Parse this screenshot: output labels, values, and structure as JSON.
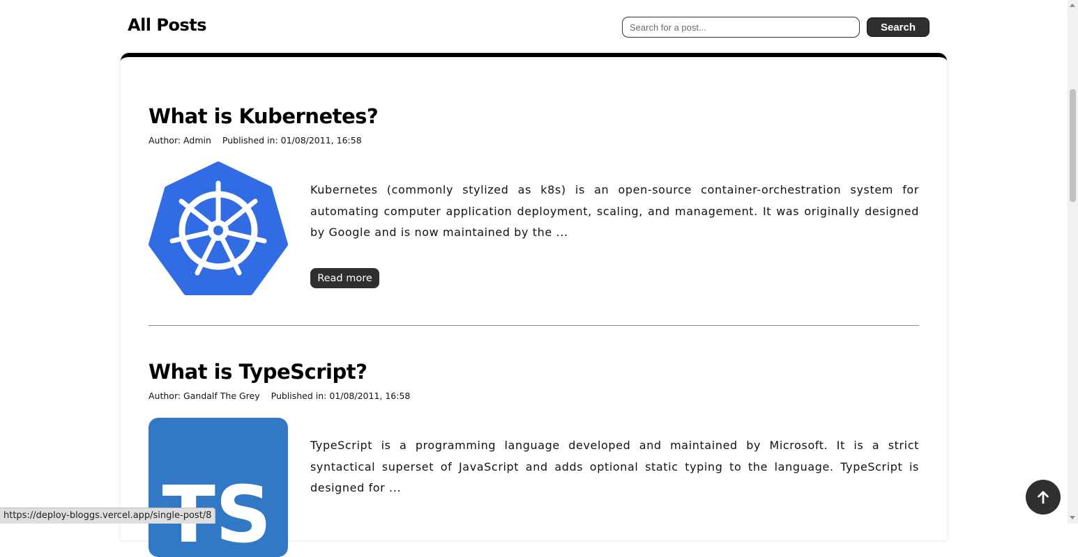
{
  "header": {
    "title": "All Posts",
    "search_placeholder": "Search for a post...",
    "search_button": "Search"
  },
  "posts": [
    {
      "title": "What is Kubernetes?",
      "author": "Author: Admin",
      "published": "Published in: 01/08/2011, 16:58",
      "excerpt": "Kubernetes (commonly stylized as k8s) is an open-source container-orchestration system for automating computer application deployment, scaling, and management. It was originally designed by Google and is now maintained by the ...",
      "read_more": "Read more",
      "image_icon": "kubernetes-logo",
      "image_color": "#326ce5"
    },
    {
      "title": "What is TypeScript?",
      "author": "Author: Gandalf The Grey",
      "published": "Published in: 01/08/2011, 16:58",
      "excerpt": "TypeScript is a programming language developed and maintained by Microsoft. It is a strict syntactical superset of JavaScript and adds optional static typing to the language. TypeScript is designed for ...",
      "image_icon": "typescript-logo",
      "image_color": "#3178c6",
      "image_text": "TS"
    }
  ],
  "scroll_top_icon": "arrow-up-icon",
  "status_bar": {
    "url": "https://deploy-bloggs.vercel.app/single-post/8"
  }
}
